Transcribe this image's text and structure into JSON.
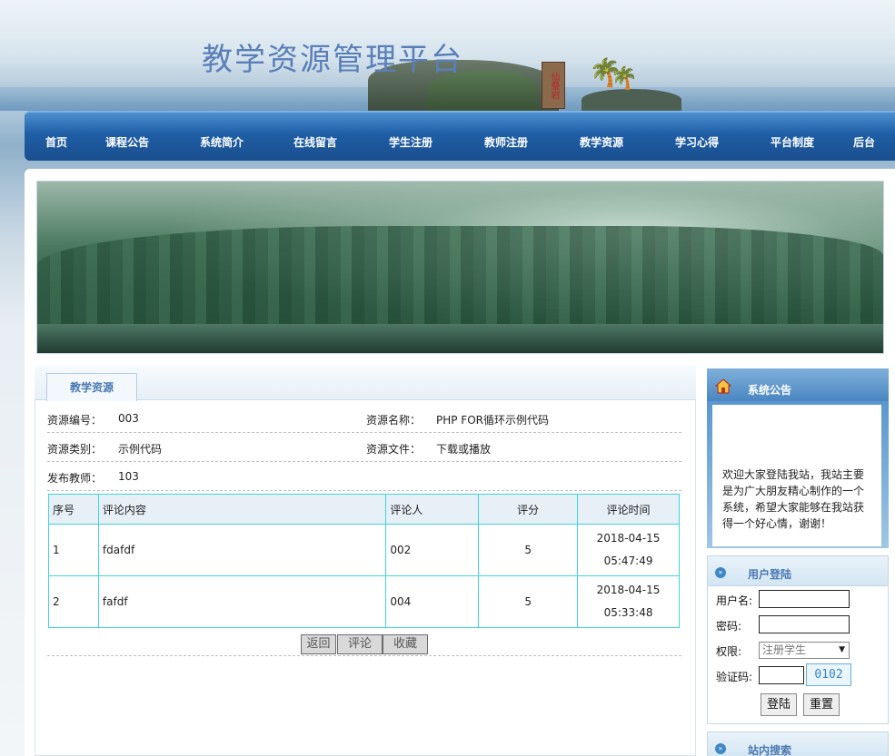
{
  "header": {
    "site_title": "教学资源管理平台",
    "seal_text": "仙叠岩"
  },
  "nav": {
    "items": [
      {
        "label": "首页"
      },
      {
        "label": "课程公告"
      },
      {
        "label": "系统简介"
      },
      {
        "label": "在线留言"
      },
      {
        "label": "学生注册"
      },
      {
        "label": "教师注册"
      },
      {
        "label": "教学资源"
      },
      {
        "label": "学习心得"
      },
      {
        "label": "平台制度"
      },
      {
        "label": "后台"
      }
    ]
  },
  "main": {
    "tab_label": "教学资源",
    "info": {
      "id_label": "资源编号：",
      "id_value": "003",
      "name_label": "资源名称：",
      "name_value": "PHP FOR循环示例代码",
      "type_label": "资源类别：",
      "type_value": "示例代码",
      "file_label": "资源文件：",
      "file_value": "下载或播放",
      "teacher_label": "发布教师：",
      "teacher_value": "103"
    },
    "comments": {
      "headers": [
        "序号",
        "评论内容",
        "评论人",
        "评分",
        "评论时间"
      ],
      "rows": [
        {
          "no": "1",
          "content": "fdafdf",
          "user": "002",
          "score": "5",
          "date": "2018-04-15",
          "time": "05:47:49"
        },
        {
          "no": "2",
          "content": "fafdf",
          "user": "004",
          "score": "5",
          "date": "2018-04-15",
          "time": "05:33:48"
        }
      ]
    },
    "buttons": {
      "back": "返回",
      "comment": "评论",
      "favorite": "收藏"
    }
  },
  "sidebar": {
    "notice_title": "系统公告",
    "notice_text": "欢迎大家登陆我站，我站主要是为广大朋友精心制作的一个系统，希望大家能够在我站获得一个好心情，谢谢！",
    "login": {
      "title": "用户登陆",
      "username_label": "用户名:",
      "password_label": "密码:",
      "role_label": "权限:",
      "role_selected": "注册学生",
      "captcha_label": "验证码:",
      "captcha_code": "0102",
      "login_button": "登陆",
      "reset_button": "重置"
    },
    "search_title": "站内搜索"
  },
  "colors": {
    "nav_blue": "#1f5ea6",
    "title_blue": "#5a7fb8",
    "table_border": "#3fd3e3",
    "tab_text": "#4a79b1"
  }
}
